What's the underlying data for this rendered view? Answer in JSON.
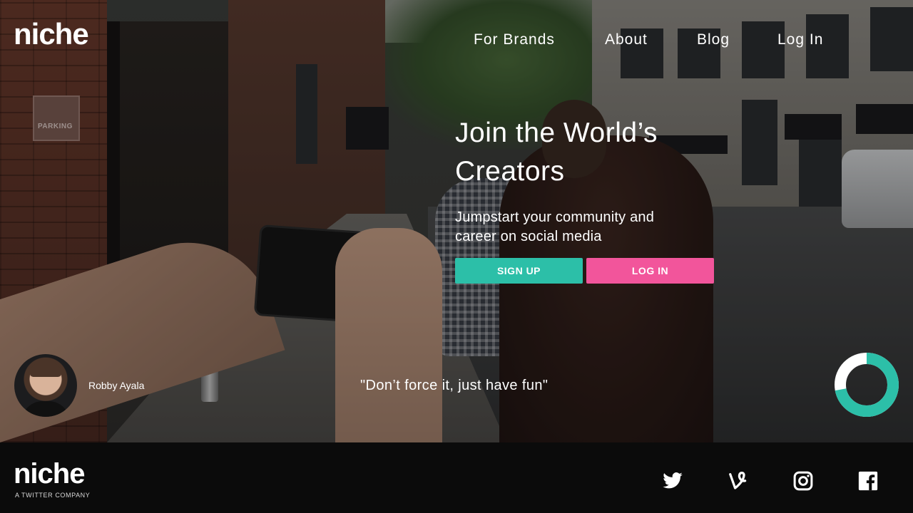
{
  "header": {
    "logo": "niche",
    "nav": [
      "For Brands",
      "About",
      "Blog",
      "Log In"
    ]
  },
  "hero": {
    "headline": "Join the World’s Creators",
    "subhead": "Jumpstart your community and career on social media",
    "signup_label": "SIGN UP",
    "login_label": "LOG IN",
    "creator_name": "Robby Ayala",
    "quote": "\"Don’t force it, just have fun\"",
    "background_sign": "PARKING"
  },
  "progress": {
    "value": 0.72,
    "color": "#2cbfa8"
  },
  "footer": {
    "logo": "niche",
    "tagline": "A TWITTER COMPANY",
    "social_icons": [
      "twitter-icon",
      "vine-icon",
      "instagram-icon",
      "facebook-icon"
    ]
  },
  "colors": {
    "signup": "#2cbfa8",
    "login": "#f2559b",
    "footer_bg": "#0b0b0b"
  }
}
